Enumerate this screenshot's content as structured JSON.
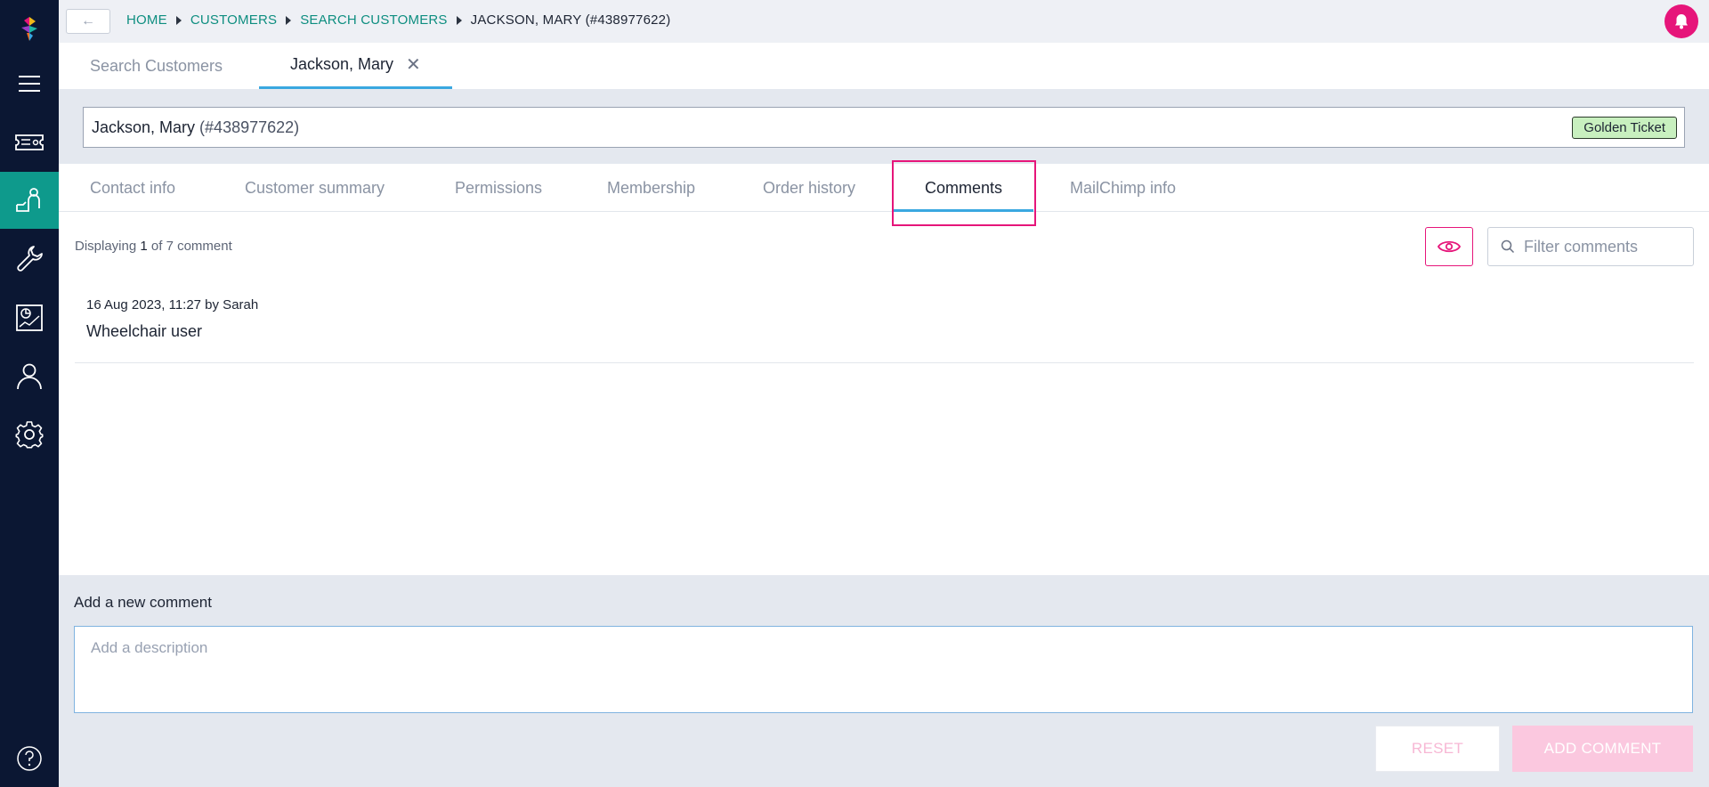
{
  "sidebar": {
    "items": [
      {
        "name": "menu",
        "icon": "hamburger-icon"
      },
      {
        "name": "tickets",
        "icon": "ticket-icon"
      },
      {
        "name": "customers",
        "icon": "customer-service-icon",
        "active": true
      },
      {
        "name": "tools",
        "icon": "wrench-icon"
      },
      {
        "name": "reports",
        "icon": "report-chart-icon"
      },
      {
        "name": "users",
        "icon": "person-icon"
      },
      {
        "name": "settings",
        "icon": "gear-icon"
      }
    ],
    "help_icon": "help-icon"
  },
  "breadcrumb": {
    "items": [
      "HOME",
      "CUSTOMERS",
      "SEARCH CUSTOMERS"
    ],
    "current": "JACKSON, MARY (#438977622)"
  },
  "top_tabs": {
    "search": "Search Customers",
    "customer": "Jackson, Mary"
  },
  "customer": {
    "name": "Jackson, Mary",
    "id": "(#438977622)",
    "badge": "Golden Ticket"
  },
  "sub_tabs": [
    "Contact info",
    "Customer summary",
    "Permissions",
    "Membership",
    "Order history",
    "Comments",
    "MailChimp info"
  ],
  "comments": {
    "display_prefix": "Displaying",
    "display_shown": "1",
    "display_suffix": "of 7 comment",
    "filter_placeholder": "Filter comments",
    "items": [
      {
        "meta": "16 Aug 2023, 11:27 by Sarah",
        "text": "Wheelchair user"
      }
    ]
  },
  "add_comment": {
    "label": "Add a new comment",
    "placeholder": "Add a description",
    "reset_label": "RESET",
    "add_label": "ADD COMMENT"
  },
  "colors": {
    "sidebar_bg": "#0b1733",
    "accent_teal": "#0e9a8c",
    "accent_pink": "#e6157a",
    "tab_underline": "#3aa8e0"
  }
}
